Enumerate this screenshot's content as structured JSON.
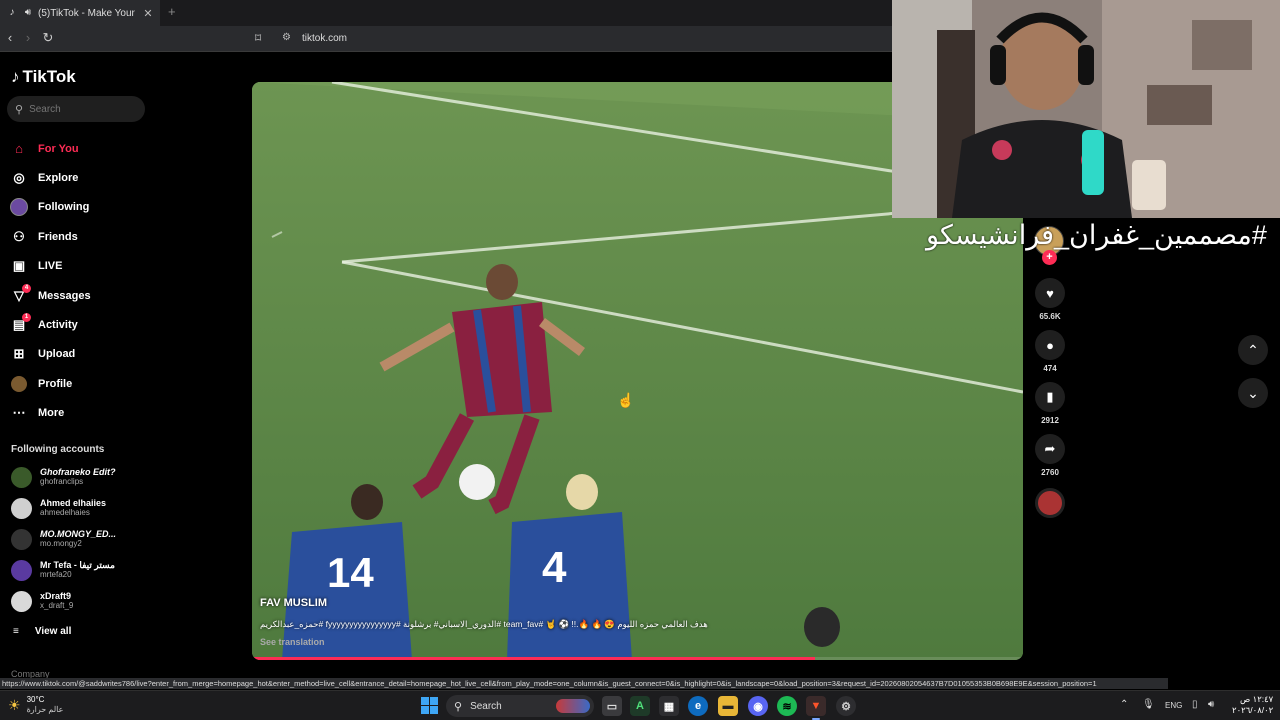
{
  "browser": {
    "tab_title": "(5)TikTok - Make Your Day",
    "tab_close": "✕",
    "new_tab": "+",
    "url": "tiktok.com",
    "status_url": "https://www.tiktok.com/@saddwrites786/live?enter_from_merge=homepage_hot&enter_method=live_cell&entrance_detail=homepage_hot_live_cell&from_play_mode=one_column&is_guest_connect=0&is_highlight=0&is_landscape=0&load_position=3&request_id=20260802054637B7D01055353B0B698E9E&session_position=1"
  },
  "sidebar": {
    "logo_text": "TikTok",
    "search_placeholder": "Search",
    "nav": [
      {
        "label": "For You",
        "icon": "home-icon",
        "glyph": "⌂"
      },
      {
        "label": "Explore",
        "icon": "compass-icon",
        "glyph": "◎"
      },
      {
        "label": "Following",
        "icon": "following-avatar-icon",
        "glyph": ""
      },
      {
        "label": "Friends",
        "icon": "friends-icon",
        "glyph": "⚇"
      },
      {
        "label": "LIVE",
        "icon": "live-icon",
        "glyph": "▣"
      },
      {
        "label": "Messages",
        "icon": "messages-icon",
        "glyph": "▽",
        "badge": "4"
      },
      {
        "label": "Activity",
        "icon": "activity-icon",
        "glyph": "▤",
        "badge": "1"
      },
      {
        "label": "Upload",
        "icon": "upload-icon",
        "glyph": "⊞"
      },
      {
        "label": "Profile",
        "icon": "profile-avatar-icon",
        "glyph": ""
      },
      {
        "label": "More",
        "icon": "more-icon",
        "glyph": "⋯"
      }
    ],
    "following_title": "Following accounts",
    "accounts": [
      {
        "name": "Ghofraneko Edit?",
        "handle": "ghofranclips",
        "color": "#3a5a2a",
        "italic": true
      },
      {
        "name": "Ahmed elhaiies",
        "handle": "ahmedelhaies",
        "color": "#cfcfcf",
        "italic": false
      },
      {
        "name": "MO.MONGY_ED...",
        "handle": "mo.mongy2",
        "color": "#333333",
        "italic": true
      },
      {
        "name": "Mr Tefa - مستر تيفا",
        "handle": "mrtefa20",
        "color": "#5a3aa0",
        "italic": false
      },
      {
        "name": "xDraft9",
        "handle": "x_draft_9",
        "color": "#d9d9d9",
        "italic": false
      }
    ],
    "view_all": "View all",
    "company": "Company"
  },
  "video": {
    "author": "FAV MUSLIM",
    "description": "حمزه_عبدالكريم# fyyyyyyyyyyyyyyyy# الدوري_الاسباني# برشلونة# team_fav# 🤘 ⚽ !!.🔥 🔥 😍 هدف العالمي حمزه الليوم",
    "see_translation": "See translation",
    "progress": 0.73
  },
  "actions": {
    "likes": "65.6K",
    "comments": "474",
    "saves": "2912",
    "shares": "2760"
  },
  "overlay_text": "#مصممين_غفران_فرانشيسكو",
  "taskbar": {
    "temperature": "30°C",
    "weather_desc": "عالم حرارة",
    "search_label": "Search",
    "language": "ENG",
    "time": "١٢:٤٧ ص",
    "date": "٢٠٢٦/٠٨/٠٢"
  },
  "colors": {
    "accent": "#fe2c55",
    "pitch": "#5f8a4a",
    "home_kit": "#2a4f9c",
    "away_kit": "#8a2040"
  }
}
